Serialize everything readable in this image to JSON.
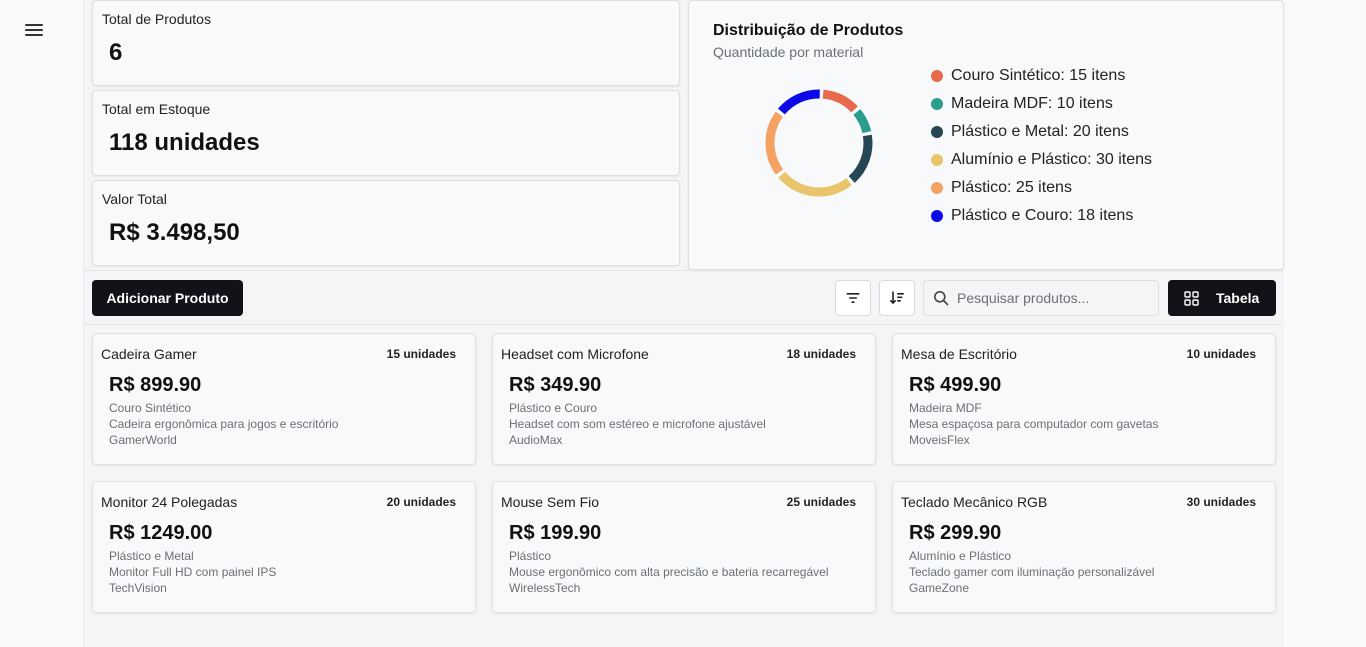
{
  "nav": {
    "menu_icon": "hamburger-menu-icon"
  },
  "stats": {
    "total_products_label": "Total de Produtos",
    "total_products_value": "6",
    "total_stock_label": "Total em Estoque",
    "total_stock_value": "118 unidades",
    "total_value_label": "Valor Total",
    "total_value_value": "R$ 3.498,50"
  },
  "chart": {
    "title": "Distribuição de Produtos",
    "subtitle": "Quantidade por material"
  },
  "chart_data": {
    "type": "pie",
    "title": "Distribuição de Produtos",
    "subtitle": "Quantidade por material",
    "legend_position": "right",
    "categories": [
      "Couro Sintético",
      "Madeira MDF",
      "Plástico e Metal",
      "Alumínio e Plástico",
      "Plástico",
      "Plástico e Couro"
    ],
    "values": [
      15,
      10,
      20,
      30,
      25,
      18
    ],
    "colors": [
      "#e8694b",
      "#2a9d8f",
      "#264653",
      "#e9c46a",
      "#f4a261",
      "#0a0ae6"
    ],
    "legend_labels": [
      "Couro Sintético: 15 itens",
      "Madeira MDF: 10 itens",
      "Plástico e Metal: 20 itens",
      "Alumínio e Plástico: 30 itens",
      "Plástico: 25 itens",
      "Plástico e Couro: 18 itens"
    ]
  },
  "toolbar": {
    "add_label": "Adicionar Produto",
    "filter_icon": "filter-icon",
    "sort_icon": "sort-icon",
    "search_icon": "search-icon",
    "search_placeholder": "Pesquisar produtos...",
    "view_icon": "grid-icon",
    "view_label": "Tabela"
  },
  "products": [
    {
      "name": "Cadeira Gamer",
      "quantity": "15 unidades",
      "price": "R$ 899.90",
      "material": "Couro Sintético",
      "description": "Cadeira ergonômica para jogos e escritório",
      "supplier": "GamerWorld"
    },
    {
      "name": "Headset com Microfone",
      "quantity": "18 unidades",
      "price": "R$ 349.90",
      "material": "Plástico e Couro",
      "description": "Headset com som estéreo e microfone ajustável",
      "supplier": "AudioMax"
    },
    {
      "name": "Mesa de Escritório",
      "quantity": "10 unidades",
      "price": "R$ 499.90",
      "material": "Madeira MDF",
      "description": "Mesa espaçosa para computador com gavetas",
      "supplier": "MoveisFlex"
    },
    {
      "name": "Monitor 24 Polegadas",
      "quantity": "20 unidades",
      "price": "R$ 1249.00",
      "material": "Plástico e Metal",
      "description": "Monitor Full HD com painel IPS",
      "supplier": "TechVision"
    },
    {
      "name": "Mouse Sem Fio",
      "quantity": "25 unidades",
      "price": "R$ 199.90",
      "material": "Plástico",
      "description": "Mouse ergonômico com alta precisão e bateria recarregável",
      "supplier": "WirelessTech"
    },
    {
      "name": "Teclado Mecânico RGB",
      "quantity": "30 unidades",
      "price": "R$ 299.90",
      "material": "Alumínio e Plástico",
      "description": "Teclado gamer com iluminação personalizável",
      "supplier": "GameZone"
    }
  ]
}
